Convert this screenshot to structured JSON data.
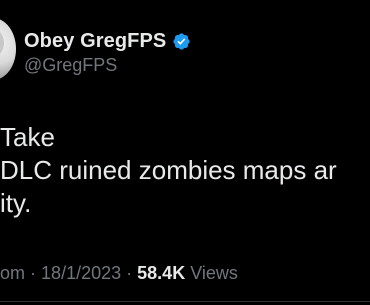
{
  "author": {
    "display_name": "Obey GregFPS",
    "handle": "@GregFPS",
    "verified_icon": "verified-badge-icon",
    "verified_color": "#1d9bf0"
  },
  "tweet": {
    "lines": [
      "Take",
      " DLC ruined zombies maps ar",
      "ity."
    ]
  },
  "meta": {
    "time_fragment": "om",
    "separator": "·",
    "date": "18/1/2023",
    "views_count": "58.4K",
    "views_label": "Views"
  },
  "colors": {
    "background": "#000000",
    "primary_text": "#e7e9ea",
    "secondary_text": "#71767b"
  }
}
